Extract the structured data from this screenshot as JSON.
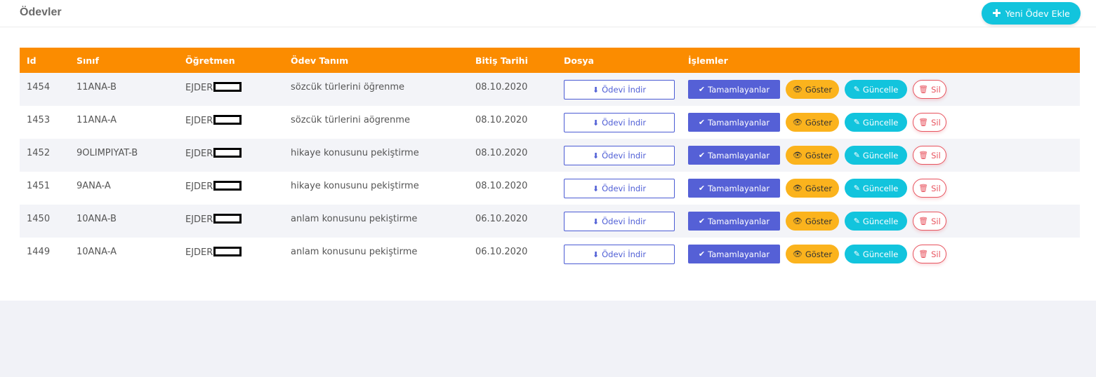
{
  "header": {
    "title": "Ödevler",
    "new_button_label": "Yeni Ödev Ekle"
  },
  "table": {
    "columns": [
      "Id",
      "Sınıf",
      "Öğretmen",
      "Ödev Tanım",
      "Bitiş Tarihi",
      "Dosya",
      "İşlemler"
    ],
    "rows": [
      {
        "id": "1454",
        "class": "11ANA-B",
        "teacher": "EJDER",
        "desc": "sözcük türlerini öğrenme",
        "date": "08.10.2020"
      },
      {
        "id": "1453",
        "class": "11ANA-A",
        "teacher": "EJDER",
        "desc": "sözcük türlerini aögrenme",
        "date": "08.10.2020"
      },
      {
        "id": "1452",
        "class": "9OLIMPIYAT-B",
        "teacher": "EJDER",
        "desc": "hikaye konusunu pekiştirme",
        "date": "08.10.2020"
      },
      {
        "id": "1451",
        "class": "9ANA-A",
        "teacher": "EJDER",
        "desc": "hikaye konusunu pekiştirme",
        "date": "08.10.2020"
      },
      {
        "id": "1450",
        "class": "10ANA-B",
        "teacher": "EJDER",
        "desc": "anlam konusunu pekiştirme",
        "date": "06.10.2020"
      },
      {
        "id": "1449",
        "class": "10ANA-A",
        "teacher": "EJDER",
        "desc": "anlam konusunu pekiştirme",
        "date": "06.10.2020"
      }
    ]
  },
  "actions": {
    "download": "Ödevi İndir",
    "completed": "Tamamlayanlar",
    "show": "Göster",
    "update": "Güncelle",
    "delete": "Sil"
  },
  "colors": {
    "header_bg": "#fb8c00",
    "accent_cyan": "#12c4dd",
    "primary": "#5560d6",
    "warning": "#fbb31d",
    "danger": "#e8545f"
  }
}
